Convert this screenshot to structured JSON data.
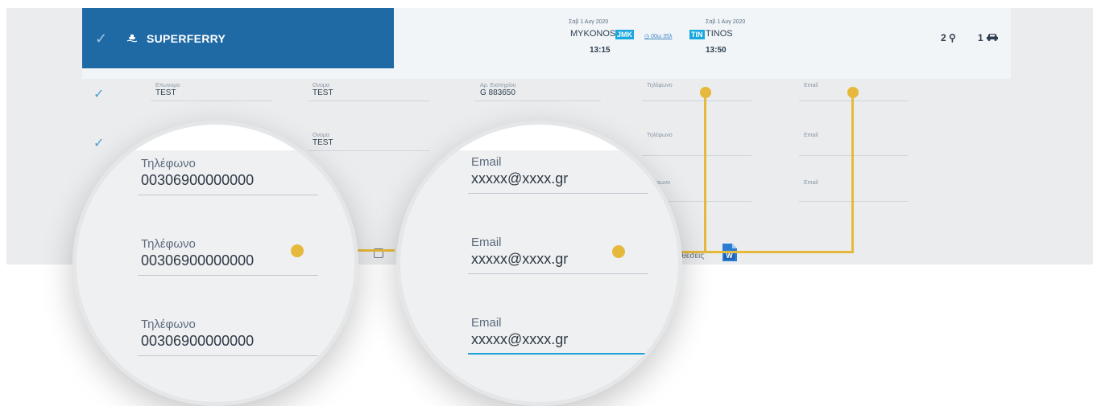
{
  "ticket": {
    "company": "SUPERFERRY",
    "depart": {
      "date": "Σαβ 1 Αυγ 2020",
      "port": "MYKONOS",
      "code": "JMK",
      "time": "13:15"
    },
    "duration": "00ω 35λ",
    "arrive": {
      "date": "Σαβ 1 Αυγ 2020",
      "port": "TINOS",
      "code": "TIN",
      "time": "13:50"
    },
    "passengers": "2",
    "vehicles": "1"
  },
  "row1": {
    "surname_label": "Επωνυμο",
    "surname": "TEST",
    "name_label": "Ονομα",
    "name": "TEST",
    "ticket_label": "Αρ. Εισιτηρίου",
    "ticket": "G  883650",
    "phone_label": "Τηλέφωνο",
    "phone": "",
    "email_label": "Email",
    "email": ""
  },
  "row2": {
    "name_label": "Ονομα",
    "name": "TEST",
    "phone_label": "Τηλέφωνο",
    "email_label": "Email"
  },
  "row3": {
    "phone_label": "λέφωνο",
    "email_label": "Email"
  },
  "footer": {
    "partial_text": "ποθεσεις"
  },
  "zoom_phone": [
    {
      "label": "Τηλέφωνο",
      "value": "00306900000000"
    },
    {
      "label": "Τηλέφωνο",
      "value": "00306900000000"
    },
    {
      "label": "Τηλέφωνο",
      "value": "00306900000000"
    }
  ],
  "zoom_email": [
    {
      "label": "Email",
      "value": "xxxxx@xxxx.gr"
    },
    {
      "label": "Email",
      "value": "xxxxx@xxxx.gr"
    },
    {
      "label": "Email",
      "value": "xxxxx@xxxx.gr"
    }
  ],
  "colors": {
    "brand": "#1f6aa5",
    "accent": "#e6b93c",
    "code_badge": "#17a8e0"
  }
}
